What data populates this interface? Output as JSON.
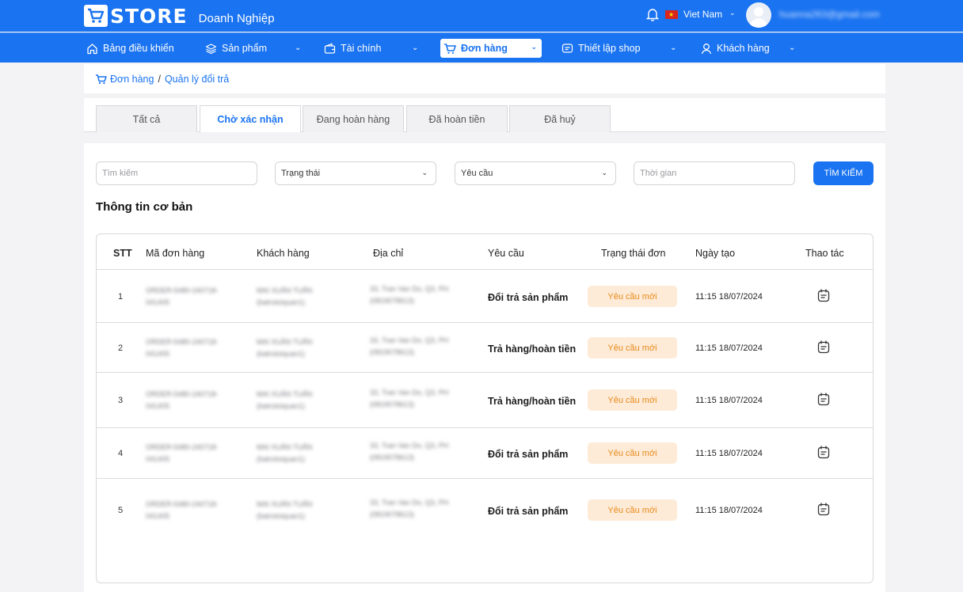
{
  "header": {
    "logo_text": "STORE",
    "logo_subtitle": "Doanh Nghiệp",
    "language": "Viet Nam",
    "email": "huanna263@gmail.com"
  },
  "nav": {
    "items": [
      {
        "label": "Bảng điều khiển",
        "icon": "home-icon"
      },
      {
        "label": "Sản phẩm",
        "icon": "layers-icon"
      },
      {
        "label": "Tài chính",
        "icon": "wallet-icon"
      },
      {
        "label": "Đơn hàng",
        "icon": "cart-icon",
        "active": true
      },
      {
        "label": "Thiết lập shop",
        "icon": "chat-icon"
      },
      {
        "label": "Khách hàng",
        "icon": "user-icon"
      }
    ]
  },
  "breadcrumb": {
    "root": "Đơn hàng",
    "separator": "/",
    "current": "Quản lý đổi trả"
  },
  "tabs": [
    "Tất cả",
    "Chờ xác nhận",
    "Đang hoàn hàng",
    "Đã hoàn tiền",
    "Đã huỷ"
  ],
  "active_tab": "Chờ xác nhận",
  "filters": {
    "search_placeholder": "Tìm kiếm",
    "status_label": "Trạng thái",
    "request_label": "Yêu cầu",
    "time_placeholder": "Thời gian",
    "search_button": "TÌM KIẾM"
  },
  "section_title": "Thông tin cơ bản",
  "table": {
    "columns": [
      "STT",
      "Mã đơn hàng",
      "Khách hàng",
      "Địa chỉ",
      "Yêu cầu",
      "Trạng thái đơn",
      "Ngày tạo",
      "Thao tác"
    ],
    "rows": [
      {
        "stt": "1",
        "order_line1": "ORDER-5480-240718-",
        "order_line2": "041405",
        "customer_line1": "MAI XUÂN TUẤN",
        "customer_line2": "(batrotoiquan1)",
        "address_line1": "33, Tran Van Do, Q3, PH",
        "address_line2": "(0819078613)",
        "request": "Đổi trả sản phẩm",
        "status": "Yêu cầu mới",
        "created": "11:15 18/07/2024"
      },
      {
        "stt": "2",
        "order_line1": "ORDER-5480-240718-",
        "order_line2": "041405",
        "customer_line1": "MAI XUÂN TUẤN",
        "customer_line2": "(batrotoiquan1)",
        "address_line1": "33, Tran Van Do, Q3, PH",
        "address_line2": "(0819078613)",
        "request": "Trả hàng/hoàn tiền",
        "status": "Yêu cầu mới",
        "created": "11:15 18/07/2024"
      },
      {
        "stt": "3",
        "order_line1": "ORDER-5480-240718-",
        "order_line2": "041405",
        "customer_line1": "MAI XUÂN TUẤN",
        "customer_line2": "(batrotoiquan1)",
        "address_line1": "33, Tran Van Do, Q3, PH",
        "address_line2": "(0819078613)",
        "request": "Trả hàng/hoàn tiền",
        "status": "Yêu cầu mới",
        "created": "11:15 18/07/2024"
      },
      {
        "stt": "4",
        "order_line1": "ORDER-5480-240718-",
        "order_line2": "041405",
        "customer_line1": "MAI XUÂN TUẤN",
        "customer_line2": "(batrotoiquan1)",
        "address_line1": "33, Tran Van Do, Q3, PH",
        "address_line2": "(0819078613)",
        "request": "Đổi trả sản phẩm",
        "status": "Yêu cầu mới",
        "created": "11:15 18/07/2024"
      },
      {
        "stt": "5",
        "order_line1": "ORDER-5480-240718-",
        "order_line2": "041405",
        "customer_line1": "MAI XUÂN TUẤN",
        "customer_line2": "(batrotoiquan1)",
        "address_line1": "33, Tran Van Do, Q3, PH",
        "address_line2": "(0819078613)",
        "request": "Đổi trả sản phẩm",
        "status": "Yêu cầu mới",
        "created": "11:15 18/07/2024"
      }
    ]
  },
  "colors": {
    "primary": "#1a73f0",
    "badge_bg": "#fdebd8",
    "badge_text": "#e88a1a"
  }
}
